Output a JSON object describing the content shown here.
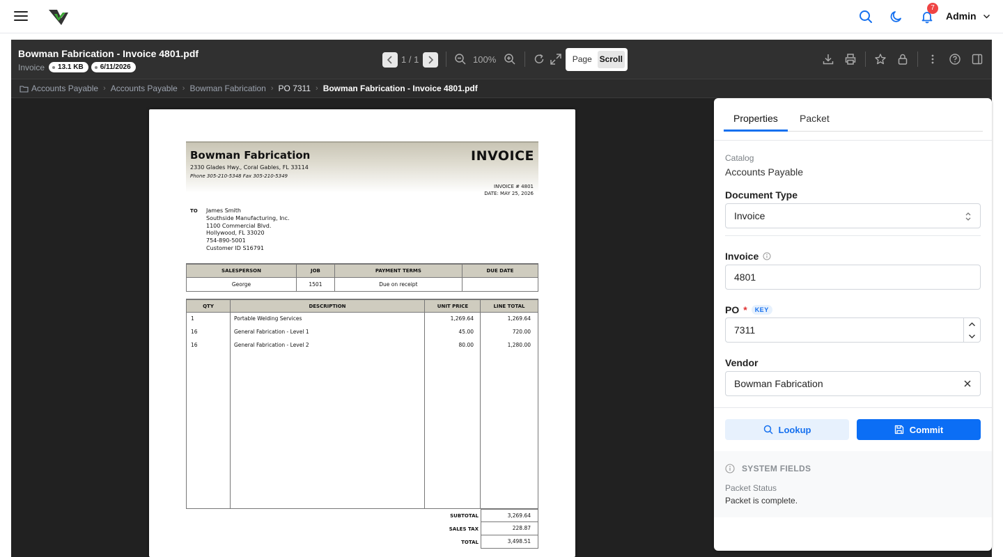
{
  "header": {
    "user": "Admin",
    "notification_count": "7"
  },
  "viewer": {
    "title": "Bowman Fabrication - Invoice 4801.pdf",
    "doc_type": "Invoice",
    "file_size": "13.1 KB",
    "date": "6/11/2026",
    "page_count": "1 / 1",
    "zoom": "100%",
    "mode_page": "Page",
    "mode_scroll": "Scroll",
    "breadcrumb": [
      "Accounts Payable",
      "Accounts Payable",
      "Bowman Fabrication",
      "PO 7311",
      "Bowman Fabrication - Invoice 4801.pdf"
    ]
  },
  "invoice": {
    "company": "Bowman Fabrication",
    "address": "2330 Glades Hwy., Coral Gables, FL 33114",
    "phone": "Phone 305-210-5348 Fax 305-210-5349",
    "heading": "INVOICE",
    "number": "INVOICE # 4801",
    "date": "DATE: MAY 25, 2026",
    "to_label": "TO",
    "to": [
      "James Smith",
      "Southside Manufacturing, Inc.",
      "1100 Commercial Blvd.",
      "Hollywood, FL 33020",
      "754-890-5001",
      "Customer ID S16791"
    ],
    "info_headers": [
      "SALESPERSON",
      "JOB",
      "PAYMENT TERMS",
      "DUE DATE"
    ],
    "info_values": [
      "George",
      "1501",
      "Due on receipt",
      ""
    ],
    "item_headers": [
      "QTY",
      "DESCRIPTION",
      "UNIT PRICE",
      "LINE TOTAL"
    ],
    "items": [
      {
        "qty": "1",
        "desc": "Portable Welding Services",
        "price": "1,269.64",
        "total": "1,269.64"
      },
      {
        "qty": "16",
        "desc": "General Fabrication - Level 1",
        "price": "45.00",
        "total": "720.00"
      },
      {
        "qty": "16",
        "desc": "General Fabrication - Level 2",
        "price": "80.00",
        "total": "1,280.00"
      }
    ],
    "subtotal_label": "SUBTOTAL",
    "subtotal": "3,269.64",
    "tax_label": "SALES TAX",
    "tax": "228.87",
    "total_label": "TOTAL",
    "total": "3,498.51"
  },
  "panel": {
    "tab_properties": "Properties",
    "tab_packet": "Packet",
    "catalog_label": "Catalog",
    "catalog_value": "Accounts Payable",
    "doc_type_label": "Document Type",
    "doc_type_value": "Invoice",
    "invoice_label": "Invoice",
    "invoice_value": "4801",
    "po_label": "PO",
    "po_required": "*",
    "po_badge": "KEY",
    "po_value": "7311",
    "vendor_label": "Vendor",
    "vendor_value": "Bowman Fabrication",
    "lookup_label": "Lookup",
    "commit_label": "Commit",
    "system_fields_label": "SYSTEM FIELDS",
    "packet_status_label": "Packet Status",
    "packet_status_value": "Packet is complete."
  },
  "colors": {
    "accent": "#1570ef",
    "commit": "#0b6ef5",
    "badge": "#ef4444",
    "viewer_bg": "#212121"
  }
}
